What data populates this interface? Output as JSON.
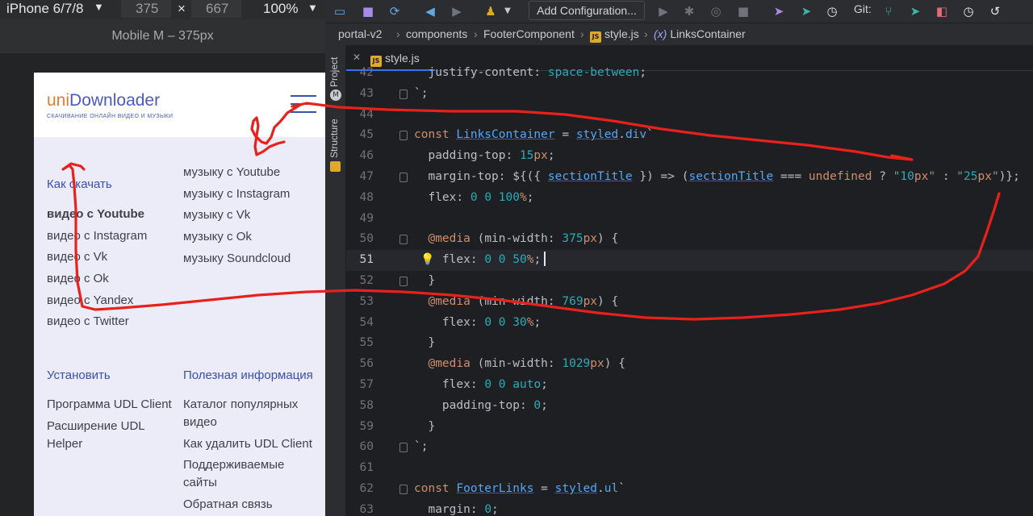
{
  "devtools": {
    "device": "iPhone 6/7/8",
    "width": "375",
    "height": "667",
    "times": "×",
    "zoom": "100%",
    "size_label": "Mobile M – 375px"
  },
  "site": {
    "logo_uni": "uni",
    "logo_rest": "Downloader",
    "tagline": "СКАЧИВАНИЕ ОНЛАЙН ВИДЕО И МУЗЫКИ",
    "brand_color": "#4a5bbd",
    "accent_color": "#e37a34",
    "how_to_download": {
      "title": "Как скачать",
      "items": [
        "видео с Youtube",
        "видео с Instagram",
        "видео с Vk",
        "видео с Ok",
        "видео с Yandex",
        "видео с Twitter"
      ]
    },
    "music_links": {
      "items": [
        "музыку с Youtube",
        "музыку с Instagram",
        "музыку с Vk",
        "музыку с Ok",
        "музыку Soundcloud"
      ]
    },
    "install": {
      "title": "Установить",
      "items": [
        "Программа UDL Client",
        "Расширение UDL Helper"
      ]
    },
    "useful": {
      "title": "Полезная информация",
      "items": [
        "Каталог популярных видео",
        "Как удалить UDL Client",
        "Поддерживаемые сайты",
        "Обратная связь"
      ]
    }
  },
  "ide": {
    "toolbar": {
      "add_config": "Add Configuration...",
      "git": "Git:"
    },
    "breadcrumb": [
      "portal-v2",
      "components",
      "FooterComponent",
      "style.js",
      "LinksContainer"
    ],
    "breadcrumb_fx": "(x)",
    "side_tabs": [
      "Project",
      "Structure"
    ],
    "file_tab": "style.js",
    "js_badge": "JS",
    "lines": [
      {
        "n": "42",
        "text": "  justify-content: space-between;"
      },
      {
        "n": "43",
        "text": "`;"
      },
      {
        "n": "44",
        "text": ""
      },
      {
        "n": "45",
        "text": "const LinksContainer = styled.div`"
      },
      {
        "n": "46",
        "text": "  padding-top: 15px;"
      },
      {
        "n": "47",
        "text": "  margin-top: ${({ sectionTitle }) => (sectionTitle === undefined ? \"10px\" : \"25px\")};"
      },
      {
        "n": "48",
        "text": "  flex: 0 0 100%;"
      },
      {
        "n": "49",
        "text": ""
      },
      {
        "n": "50",
        "text": "  @media (min-width: 375px) {"
      },
      {
        "n": "51",
        "text": "    flex: 0 0 50%;"
      },
      {
        "n": "52",
        "text": "  }"
      },
      {
        "n": "53",
        "text": "  @media (min-width: 769px) {"
      },
      {
        "n": "54",
        "text": "    flex: 0 0 30%;"
      },
      {
        "n": "55",
        "text": "  }"
      },
      {
        "n": "56",
        "text": "  @media (min-width: 1029px) {"
      },
      {
        "n": "57",
        "text": "    flex: 0 0 auto;"
      },
      {
        "n": "58",
        "text": "    padding-top: 0;"
      },
      {
        "n": "59",
        "text": "  }"
      },
      {
        "n": "60",
        "text": "`;"
      },
      {
        "n": "61",
        "text": ""
      },
      {
        "n": "62",
        "text": "const FooterLinks = styled.ul`"
      },
      {
        "n": "63",
        "text": "  margin: 0;"
      }
    ],
    "active_line": "51"
  },
  "annotation_color": "#e8211c"
}
